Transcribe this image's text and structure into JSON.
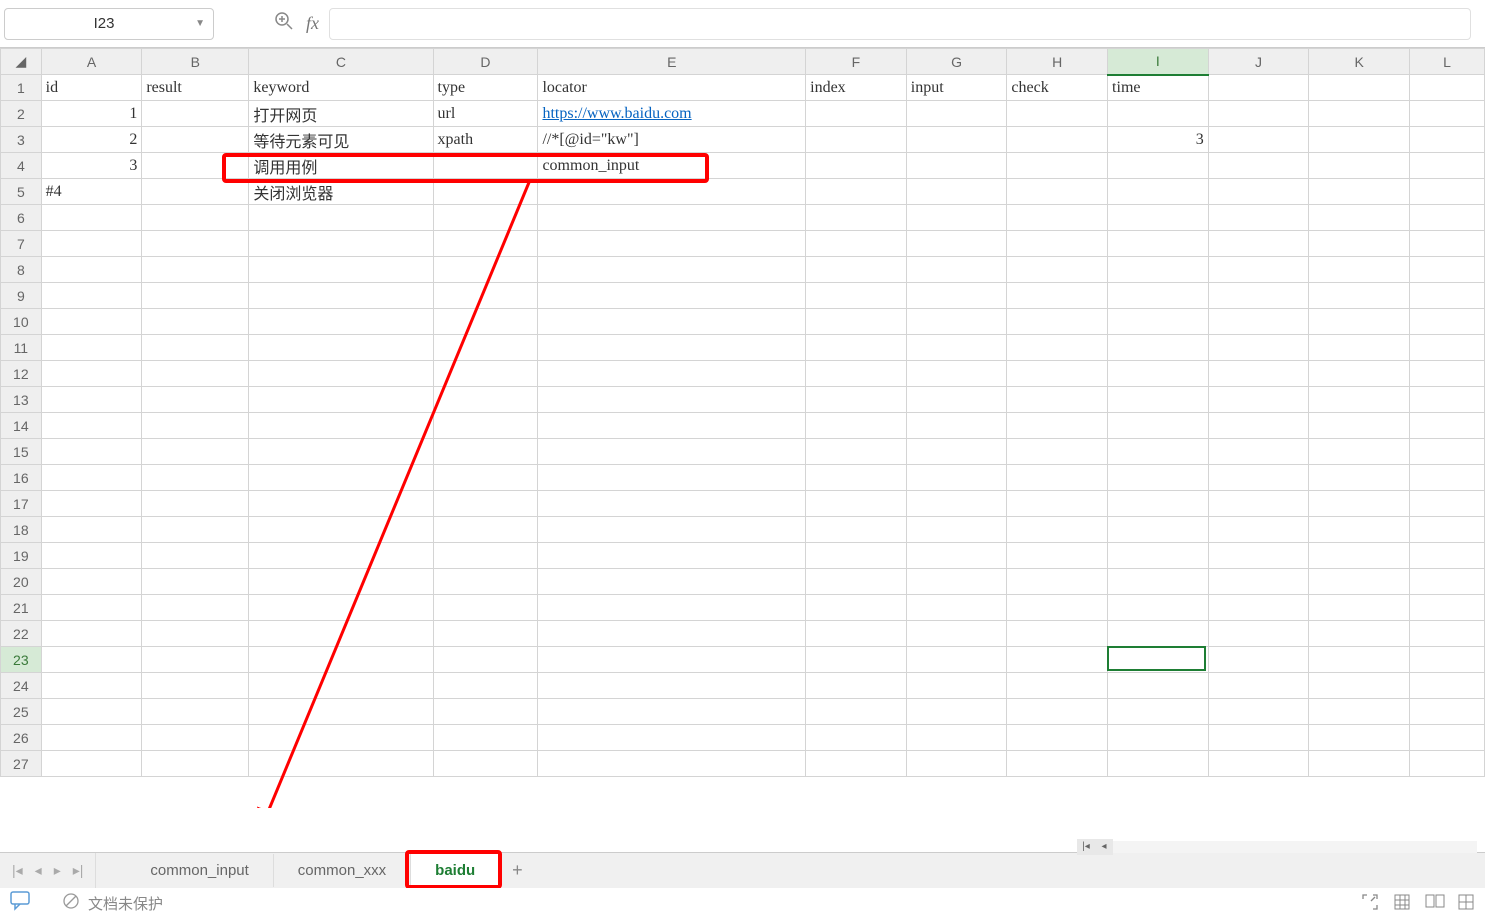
{
  "namebox": {
    "value": "I23"
  },
  "columns": [
    "A",
    "B",
    "C",
    "D",
    "E",
    "F",
    "G",
    "H",
    "I",
    "J",
    "K",
    "L"
  ],
  "selected_column": "I",
  "selected_row": 23,
  "row_count": 27,
  "headers": {
    "A": "id",
    "B": "result",
    "C": "keyword",
    "D": "type",
    "E": "locator",
    "F": "index",
    "G": "input",
    "H": "check",
    "I": "time"
  },
  "rows": [
    {
      "A": "1",
      "C": "打开网页",
      "D": "url",
      "E": "https://www.baidu.com",
      "E_link": true
    },
    {
      "A": "2",
      "C": "等待元素可见",
      "D": "xpath",
      "E": "//*[@id=\"kw\"]",
      "I": "3"
    },
    {
      "A": "3",
      "C": "调用用例",
      "E": "common_input"
    },
    {
      "A": "#4",
      "A_text": true,
      "C": "关闭浏览器"
    }
  ],
  "tabs": {
    "items": [
      "common_input",
      "common_xxx",
      "baidu"
    ],
    "active": "baidu"
  },
  "status": {
    "protection": "文档未保护"
  }
}
